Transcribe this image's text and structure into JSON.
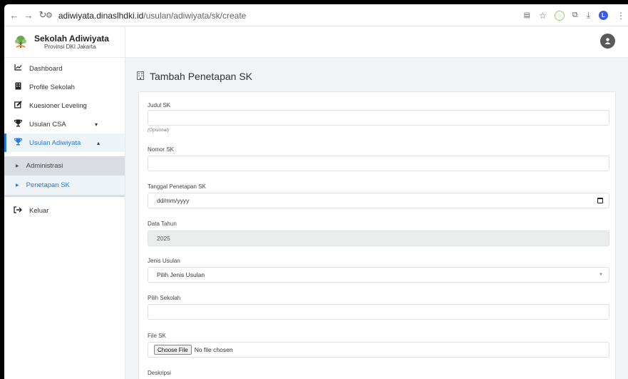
{
  "browser": {
    "url_domain": "adiwiyata.dinaslhdki.id",
    "url_path": "/usulan/adiwiyata/sk/create",
    "profile_initial": "L"
  },
  "brand": {
    "title": "Sekolah Adiwiyata",
    "subtitle": "Provinsi DKI Jakarta"
  },
  "sidebar": {
    "items": [
      {
        "label": "Dashboard",
        "icon": "chart-line-icon"
      },
      {
        "label": "Profile Sekolah",
        "icon": "building-icon"
      },
      {
        "label": "Kuesioner Leveling",
        "icon": "edit-icon"
      },
      {
        "label": "Usulan CSA",
        "icon": "trophy-icon"
      },
      {
        "label": "Usulan Adiwiyata",
        "icon": "trophy-icon"
      }
    ],
    "submenu": [
      {
        "label": "Administrasi"
      },
      {
        "label": "Penetapan SK"
      }
    ],
    "logout": {
      "label": "Keluar",
      "icon": "sign-out-icon"
    }
  },
  "page": {
    "title": "Tambah Penetapan SK"
  },
  "form": {
    "judul_label": "Judul SK",
    "judul_hint": "(Opsional)",
    "judul_value": "",
    "nomor_label": "Nomor SK",
    "nomor_value": "",
    "tanggal_label": "Tanggal Penetapan SK",
    "tanggal_placeholder": "dd/mm/yyyy",
    "tahun_label": "Data Tahun",
    "tahun_value": "2025",
    "jenis_label": "Jenis Usulan",
    "jenis_selected": "Pilih Jenis Usulan",
    "sekolah_label": "Pilih Sekolah",
    "sekolah_value": "",
    "file_label": "File SK",
    "file_button": "Choose File",
    "file_status": "No file chosen",
    "deskripsi_label": "Deskripsi"
  },
  "colors": {
    "accent": "#2b7bd8",
    "submenu_bg": "#d9dde2",
    "main_bg": "#f1f3f5"
  }
}
